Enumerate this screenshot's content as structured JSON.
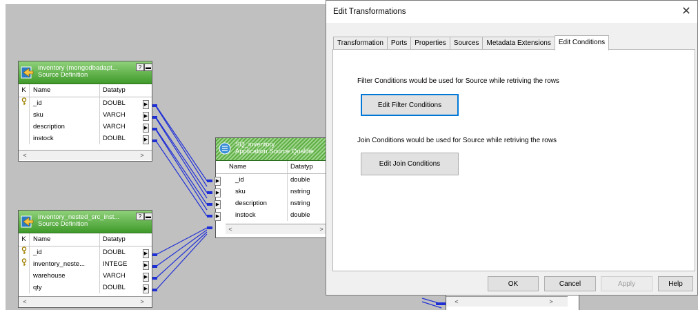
{
  "colors": {
    "header_green": "#3f9a2a",
    "link_blue": "#1f2fd6",
    "accent": "#0078d7"
  },
  "source_tables": [
    {
      "title": "inventory (mongodbadapt...",
      "subtitle": "Source Definition",
      "col_k": "K",
      "col_name": "Name",
      "col_type": "Datatyp",
      "rows": [
        {
          "key": "key-icon",
          "name": "_id",
          "type": "DOUBL"
        },
        {
          "key": "",
          "name": "sku",
          "type": "VARCH"
        },
        {
          "key": "",
          "name": "description",
          "type": "VARCH"
        },
        {
          "key": "",
          "name": "instock",
          "type": "DOUBL"
        }
      ]
    },
    {
      "title": "inventory_nested_src_inst...",
      "subtitle": "Source Definition",
      "col_k": "K",
      "col_name": "Name",
      "col_type": "Datatyp",
      "rows": [
        {
          "key": "key-icon",
          "name": "_id",
          "type": "DOUBL"
        },
        {
          "key": "key-icon",
          "name": "inventory_neste...",
          "type": "INTEGE"
        },
        {
          "key": "",
          "name": "warehouse",
          "type": "VARCH"
        },
        {
          "key": "",
          "name": "qty",
          "type": "DOUBL"
        }
      ]
    }
  ],
  "qualifier": {
    "title": "SQ_inventory",
    "subtitle": "Application Source Qualifie",
    "col_name": "Name",
    "col_type": "Datatyp",
    "rows": [
      {
        "name": "_id",
        "type": "double"
      },
      {
        "name": "sku",
        "type": "nstring"
      },
      {
        "name": "description",
        "type": "nstring"
      },
      {
        "name": "instock",
        "type": "double"
      }
    ]
  },
  "scroll": {
    "left": "<",
    "right": ">"
  },
  "dialog": {
    "title": "Edit Transformations",
    "close": "✕",
    "tabs": [
      "Transformation",
      "Ports",
      "Properties",
      "Sources",
      "Metadata Extensions",
      "Edit Conditions"
    ],
    "active_tab": "Edit Conditions",
    "filter_text": "Filter Conditions would be used for Source while retriving the rows",
    "filter_button": "Edit Filter Conditions",
    "join_text": "Join Conditions would be used for Source while retriving the rows",
    "join_button": "Edit Join Conditions",
    "ok": "OK",
    "cancel": "Cancel",
    "apply": "Apply",
    "help": "Help"
  }
}
